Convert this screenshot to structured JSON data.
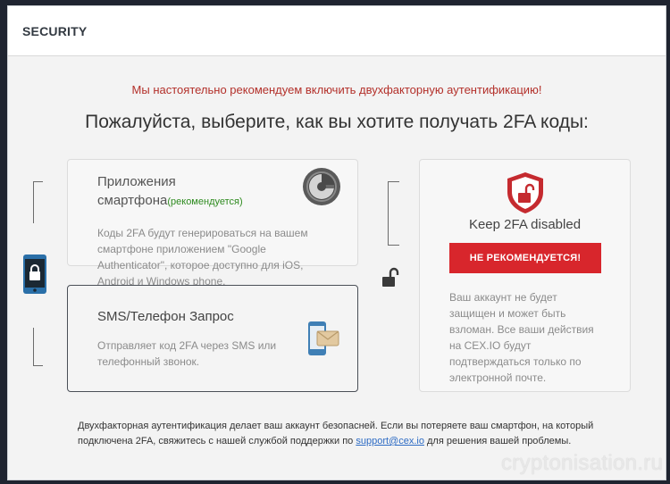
{
  "header": {
    "title": "SECURITY"
  },
  "warning": "Мы настоятельно рекомендуем включить двухфакторную аутентификацию!",
  "heading": "Пожалуйста, выберите, как вы хотите получать 2FA коды:",
  "app_option": {
    "title_line1": "Приложения",
    "title_line2": "смартфона",
    "recommended": "(рекомендуется)",
    "description": "Коды 2FA будут генерироваться на вашем смартфоне приложением \"Google Authenticator\", которое доступно для iOS, Android и Windows phone.",
    "icon": "google-authenticator-icon"
  },
  "sms_option": {
    "title": "SMS/Телефон Запрос",
    "description": "Отправляет код 2FA через SMS или телефонный звонок.",
    "icon": "phone-sms-icon"
  },
  "disabled_option": {
    "title": "Keep 2FA disabled",
    "button": "НЕ РЕКОМЕНДУЕТСЯ!",
    "description": "Ваш аккаунт не будет защищен и может быть взломан. Все ваши действия на CEX.IO будут подтверждаться только по электронной почте.",
    "icon": "shield-unlock-icon"
  },
  "footer": {
    "text_before": "Двухфакторная аутентификация делает ваш аккаунт безопасней. Если вы потеряете ваш смартфон, на который подключена 2FA, свяжитесь с нашей службой поддержки по ",
    "link": "support@cex.io",
    "text_after": " для решения вашей проблемы."
  },
  "watermark": "cryptonisation.ru",
  "colors": {
    "accent_red": "#d8262c",
    "warning_red": "#b3302a",
    "recommended_green": "#2e8b1f",
    "link_blue": "#2d6bc4"
  }
}
